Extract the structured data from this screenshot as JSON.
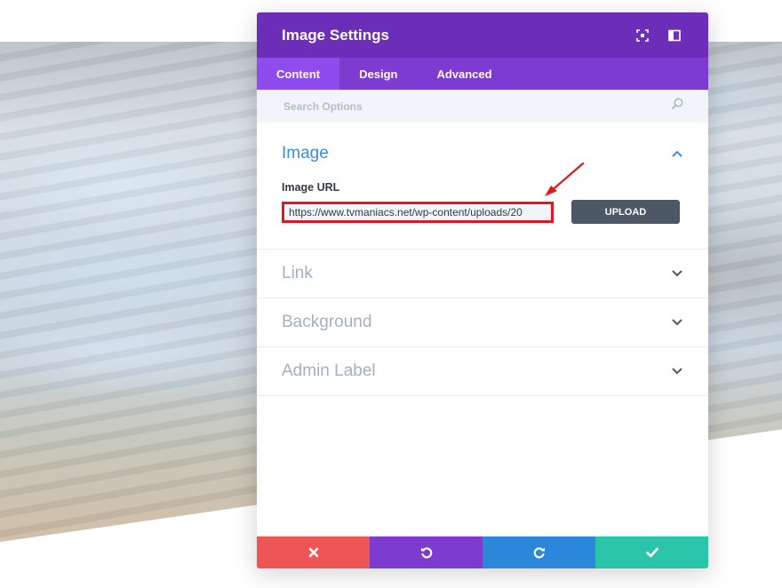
{
  "modal": {
    "title": "Image Settings",
    "header_icons": [
      "expand-icon",
      "sidebar-toggle-icon"
    ]
  },
  "tabs": [
    {
      "label": "Content",
      "active": true
    },
    {
      "label": "Design",
      "active": false
    },
    {
      "label": "Advanced",
      "active": false
    }
  ],
  "search": {
    "placeholder": "Search Options",
    "value": ""
  },
  "sections": {
    "image": {
      "title": "Image",
      "expanded": true,
      "field_label": "Image URL",
      "url_value": "https://www.tvmaniacs.net/wp-content/uploads/20",
      "upload_label": "UPLOAD"
    },
    "link": {
      "title": "Link",
      "expanded": false
    },
    "background": {
      "title": "Background",
      "expanded": false
    },
    "admin_label": {
      "title": "Admin Label",
      "expanded": false
    }
  },
  "footer": {
    "buttons": [
      "close-icon",
      "undo-icon",
      "redo-icon",
      "check-icon"
    ]
  },
  "colors": {
    "header": "#6c2eb9",
    "tabs": "#7d3bd1",
    "active_tab": "#8f4bee",
    "section_open": "#3f8bd6",
    "highlight": "#e3161f",
    "cancel": "#ef5555",
    "undo": "#7e3bd0",
    "redo": "#2b87da",
    "save": "#29c4a9"
  }
}
